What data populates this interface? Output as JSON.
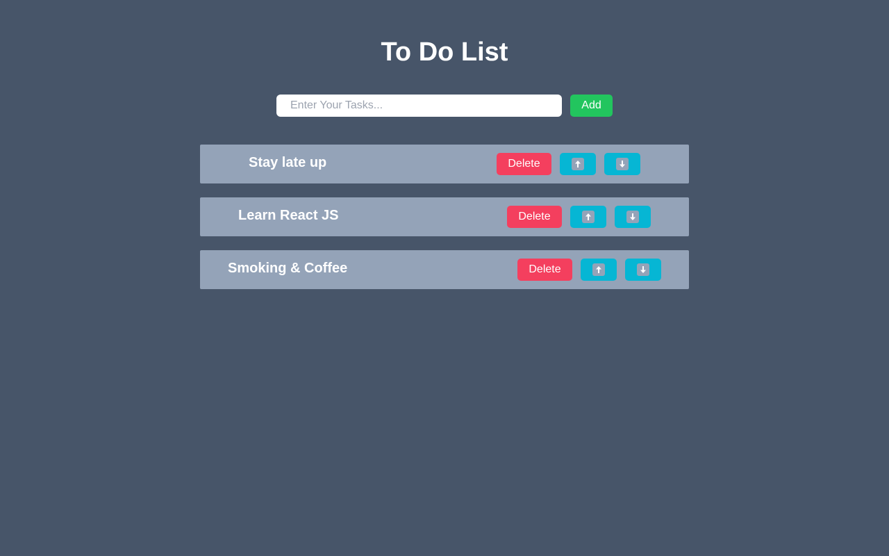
{
  "header": {
    "title": "To Do List"
  },
  "add_form": {
    "placeholder": "Enter Your Tasks...",
    "value": "",
    "add_label": "Add"
  },
  "tasks": [
    {
      "text": "Stay late up",
      "delete_label": "Delete",
      "up_icon": "arrow-up-icon",
      "down_icon": "arrow-down-icon"
    },
    {
      "text": "Learn React JS",
      "delete_label": "Delete",
      "up_icon": "arrow-up-icon",
      "down_icon": "arrow-down-icon"
    },
    {
      "text": "Smoking & Coffee",
      "delete_label": "Delete",
      "up_icon": "arrow-up-icon",
      "down_icon": "arrow-down-icon"
    }
  ],
  "colors": {
    "background": "#475569",
    "row": "#94a3b8",
    "add": "#22c55e",
    "delete": "#f43f5e",
    "move": "#06b6d4"
  }
}
